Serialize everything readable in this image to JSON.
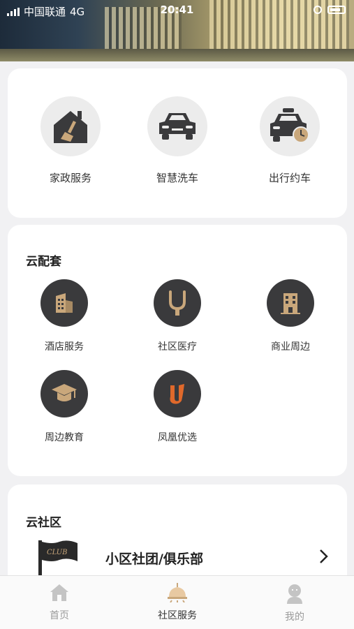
{
  "status_bar": {
    "carrier": "中国联通",
    "network": "4G",
    "time": "20:41"
  },
  "services": [
    {
      "label": "家政服务",
      "icon": "house-broom-icon"
    },
    {
      "label": "智慧洗车",
      "icon": "car-icon"
    },
    {
      "label": "出行约车",
      "icon": "taxi-clock-icon"
    }
  ],
  "cloud_facilities": {
    "title": "云配套",
    "items": [
      {
        "label": "酒店服务",
        "icon": "hotel-building-icon"
      },
      {
        "label": "社区医疗",
        "icon": "stethoscope-icon"
      },
      {
        "label": "商业周边",
        "icon": "office-building-icon"
      },
      {
        "label": "周边教育",
        "icon": "graduation-cap-icon"
      },
      {
        "label": "凤凰优选",
        "icon": "phoenix-logo-icon"
      }
    ]
  },
  "cloud_community": {
    "title": "云社区",
    "club": {
      "label": "小区社团/俱乐部",
      "flag_text": "CLUB"
    }
  },
  "tabbar": [
    {
      "label": "首页",
      "icon": "home-icon"
    },
    {
      "label": "社区服务",
      "icon": "community-lamp-icon"
    },
    {
      "label": "我的",
      "icon": "user-icon"
    }
  ],
  "colors": {
    "accent_gold": "#c9a77b",
    "dark_icon_bg": "#3a3a3c",
    "page_bg": "#f1f1f3"
  }
}
